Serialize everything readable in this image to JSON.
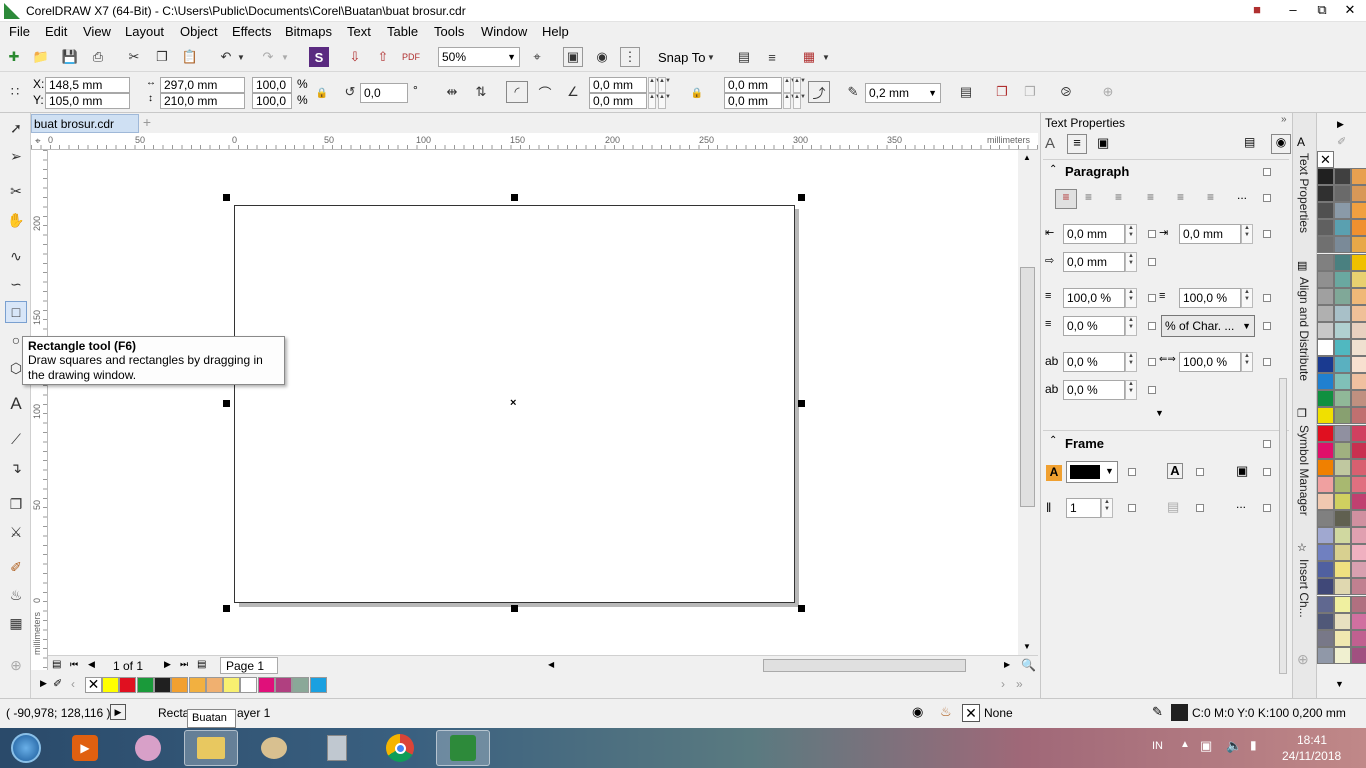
{
  "window": {
    "title": "CorelDRAW X7 (64-Bit) - C:\\Users\\Public\\Documents\\Corel\\Buatan\\buat brosur.cdr"
  },
  "menu": [
    "File",
    "Edit",
    "View",
    "Layout",
    "Object",
    "Effects",
    "Bitmaps",
    "Text",
    "Table",
    "Tools",
    "Window",
    "Help"
  ],
  "toolbar": {
    "zoom": "50%",
    "snap_to": "Snap To"
  },
  "props": {
    "x": "148,5 mm",
    "y": "105,0 mm",
    "width": "297,0 mm",
    "height": "210,0 mm",
    "scale_w": "100,0",
    "scale_h": "100,0",
    "percent": "%",
    "angle": "0,0",
    "degree": "°",
    "corner1": "0,0 mm",
    "corner2": "0,0 mm",
    "corner3": "0,0 mm",
    "corner4": "0,0 mm",
    "outline": "0,2 mm"
  },
  "doc_tab": "buat brosur.cdr",
  "ruler": {
    "h_ticks": [
      "0",
      "50",
      "0",
      "50",
      "100",
      "150",
      "200",
      "250",
      "300",
      "350"
    ],
    "unit": "millimeters",
    "v_ticks": [
      "200",
      "150",
      "100",
      "50",
      "0"
    ]
  },
  "tooltip": {
    "title": "Rectangle tool (F6)",
    "body": "Draw squares and rectangles by dragging in the drawing window."
  },
  "pagebar": {
    "page_count": "1 of 1",
    "page_tab": "Page 1"
  },
  "docker": {
    "title": "Text Properties",
    "paragraph": {
      "header": "Paragraph",
      "left_indent": "0,0 mm",
      "right_indent": "0,0 mm",
      "first_indent": "0,0 mm",
      "para_spacing_before": "100,0 %",
      "line_spacing": "100,0 %",
      "para_spacing_after": "0,0 %",
      "spacing_unit": "% of Char. ...",
      "char_spacing": "0,0 %",
      "word_spacing": "100,0 %",
      "lang_spacing": "0,0 %"
    },
    "frame": {
      "header": "Frame",
      "columns": "1"
    }
  },
  "docker_tabs": [
    "Text Properties",
    "Align and Distribute",
    "Symbol Manager",
    "Insert Ch..."
  ],
  "status": {
    "coords": "( -90,978; 128,116 )",
    "object": "Recta",
    "layer": "ayer 1",
    "tooltip": "Buatan",
    "fill": "None",
    "outline": "C:0 M:0 Y:0 K:100  0,200 mm"
  },
  "taskbar": {
    "lang": "IN",
    "time": "18:41",
    "date": "24/11/2018"
  },
  "colors": {
    "doc_palette": [
      "#ffff00",
      "#e01020",
      "#1a9a3a",
      "#202020",
      "#f2a030",
      "#f2b040",
      "#f0b070",
      "#f8f070",
      "#ffffff",
      "#e0107a",
      "#b04080",
      "#8aa898",
      "#1aa0e0"
    ],
    "color_palette": [
      [
        "#202020",
        "#404040",
        "#e8a050"
      ],
      [
        "#303030",
        "#6a6a6a",
        "#d89858"
      ],
      [
        "#505050",
        "#8a9aa8",
        "#f0a040"
      ],
      [
        "#606060",
        "#5aa0b0",
        "#f09030"
      ],
      [
        "#707070",
        "#7a8a98",
        "#e8a848"
      ],
      [
        "#808080",
        "#4a8080",
        "#f0c000"
      ],
      [
        "#909090",
        "#6aa8a0",
        "#e8d070"
      ],
      [
        "#a0a0a0",
        "#80a898",
        "#f0b878"
      ],
      [
        "#b0b0b0",
        "#a8c0c8",
        "#f0c098"
      ],
      [
        "#c8c8c8",
        "#b0d0d0",
        "#e8d0c0"
      ],
      [
        "#ffffff",
        "#50b8c0",
        "#f0e0d0"
      ],
      [
        "#1a3a90",
        "#5ab0c0",
        "#f8e0d0"
      ],
      [
        "#2080d0",
        "#80c0b8",
        "#f0c0a0"
      ],
      [
        "#109040",
        "#90b898",
        "#c09080"
      ],
      [
        "#f0e000",
        "#88a070",
        "#c07070"
      ],
      [
        "#e01020",
        "#9090a0",
        "#d04060"
      ],
      [
        "#e0106a",
        "#a0b080",
        "#c83050"
      ],
      [
        "#f08000",
        "#c0c8a0",
        "#d86070"
      ],
      [
        "#f0a0a0",
        "#a8b870",
        "#e07080"
      ],
      [
        "#f0c8b0",
        "#d0d060",
        "#c04070"
      ],
      [
        "#808080",
        "#606050",
        "#d090a0"
      ],
      [
        "#a0a8d0",
        "#d0d8a0",
        "#e0a0b0"
      ],
      [
        "#7080c0",
        "#d8d090",
        "#f0b0c0"
      ],
      [
        "#5060a0",
        "#f0e080",
        "#d8a0b0"
      ],
      [
        "#404878",
        "#e0d8b0",
        "#c08090"
      ],
      [
        "#606890",
        "#f0f0a0",
        "#b07080"
      ],
      [
        "#505878",
        "#e8e0c0",
        "#d070a0"
      ],
      [
        "#787888",
        "#f0e8b0",
        "#c06090"
      ],
      [
        "#9098a8",
        "#f0f0d0",
        "#a05080"
      ]
    ]
  }
}
